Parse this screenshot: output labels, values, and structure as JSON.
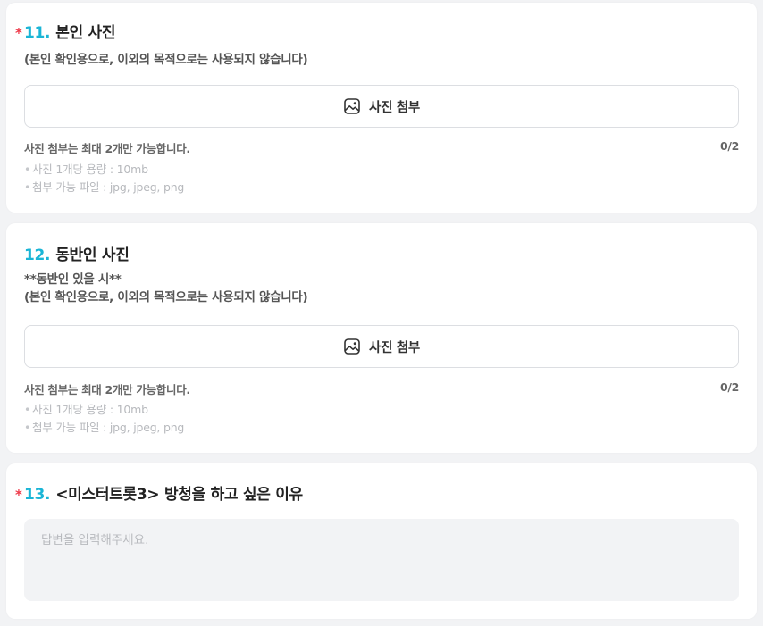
{
  "questions": [
    {
      "required_mark": "*",
      "number": "11.",
      "title": "본인 사진",
      "description": "(본인 확인용으로, 이외의 목적으로는 사용되지 않습니다)",
      "attach_label": "사진 첨부",
      "attach_icon": "image-icon",
      "limit_text": "사진 첨부는 최대 2개만 가능합니다.",
      "count": "0/2",
      "rules": [
        "사진 1개당 용량 : 10mb",
        "첨부 가능 파일 : jpg, jpeg, png"
      ]
    },
    {
      "number": "12.",
      "title": "동반인 사진",
      "description_lines": [
        "**동반인 있을 시**",
        "(본인 확인용으로, 이외의 목적으로는 사용되지 않습니다)"
      ],
      "attach_label": "사진 첨부",
      "attach_icon": "image-icon",
      "limit_text": "사진 첨부는 최대 2개만 가능합니다.",
      "count": "0/2",
      "rules": [
        "사진 1개당 용량 : 10mb",
        "첨부 가능 파일 : jpg, jpeg, png"
      ]
    },
    {
      "required_mark": "*",
      "number": "13.",
      "title": "<미스터트롯3> 방청을 하고 싶은 이유",
      "answer_placeholder": "답변을 입력해주세요.",
      "answer_value": ""
    }
  ],
  "colors": {
    "accent": "#1ab5d6",
    "required": "#ee3a4a",
    "page_background": "#f2f3f5"
  }
}
